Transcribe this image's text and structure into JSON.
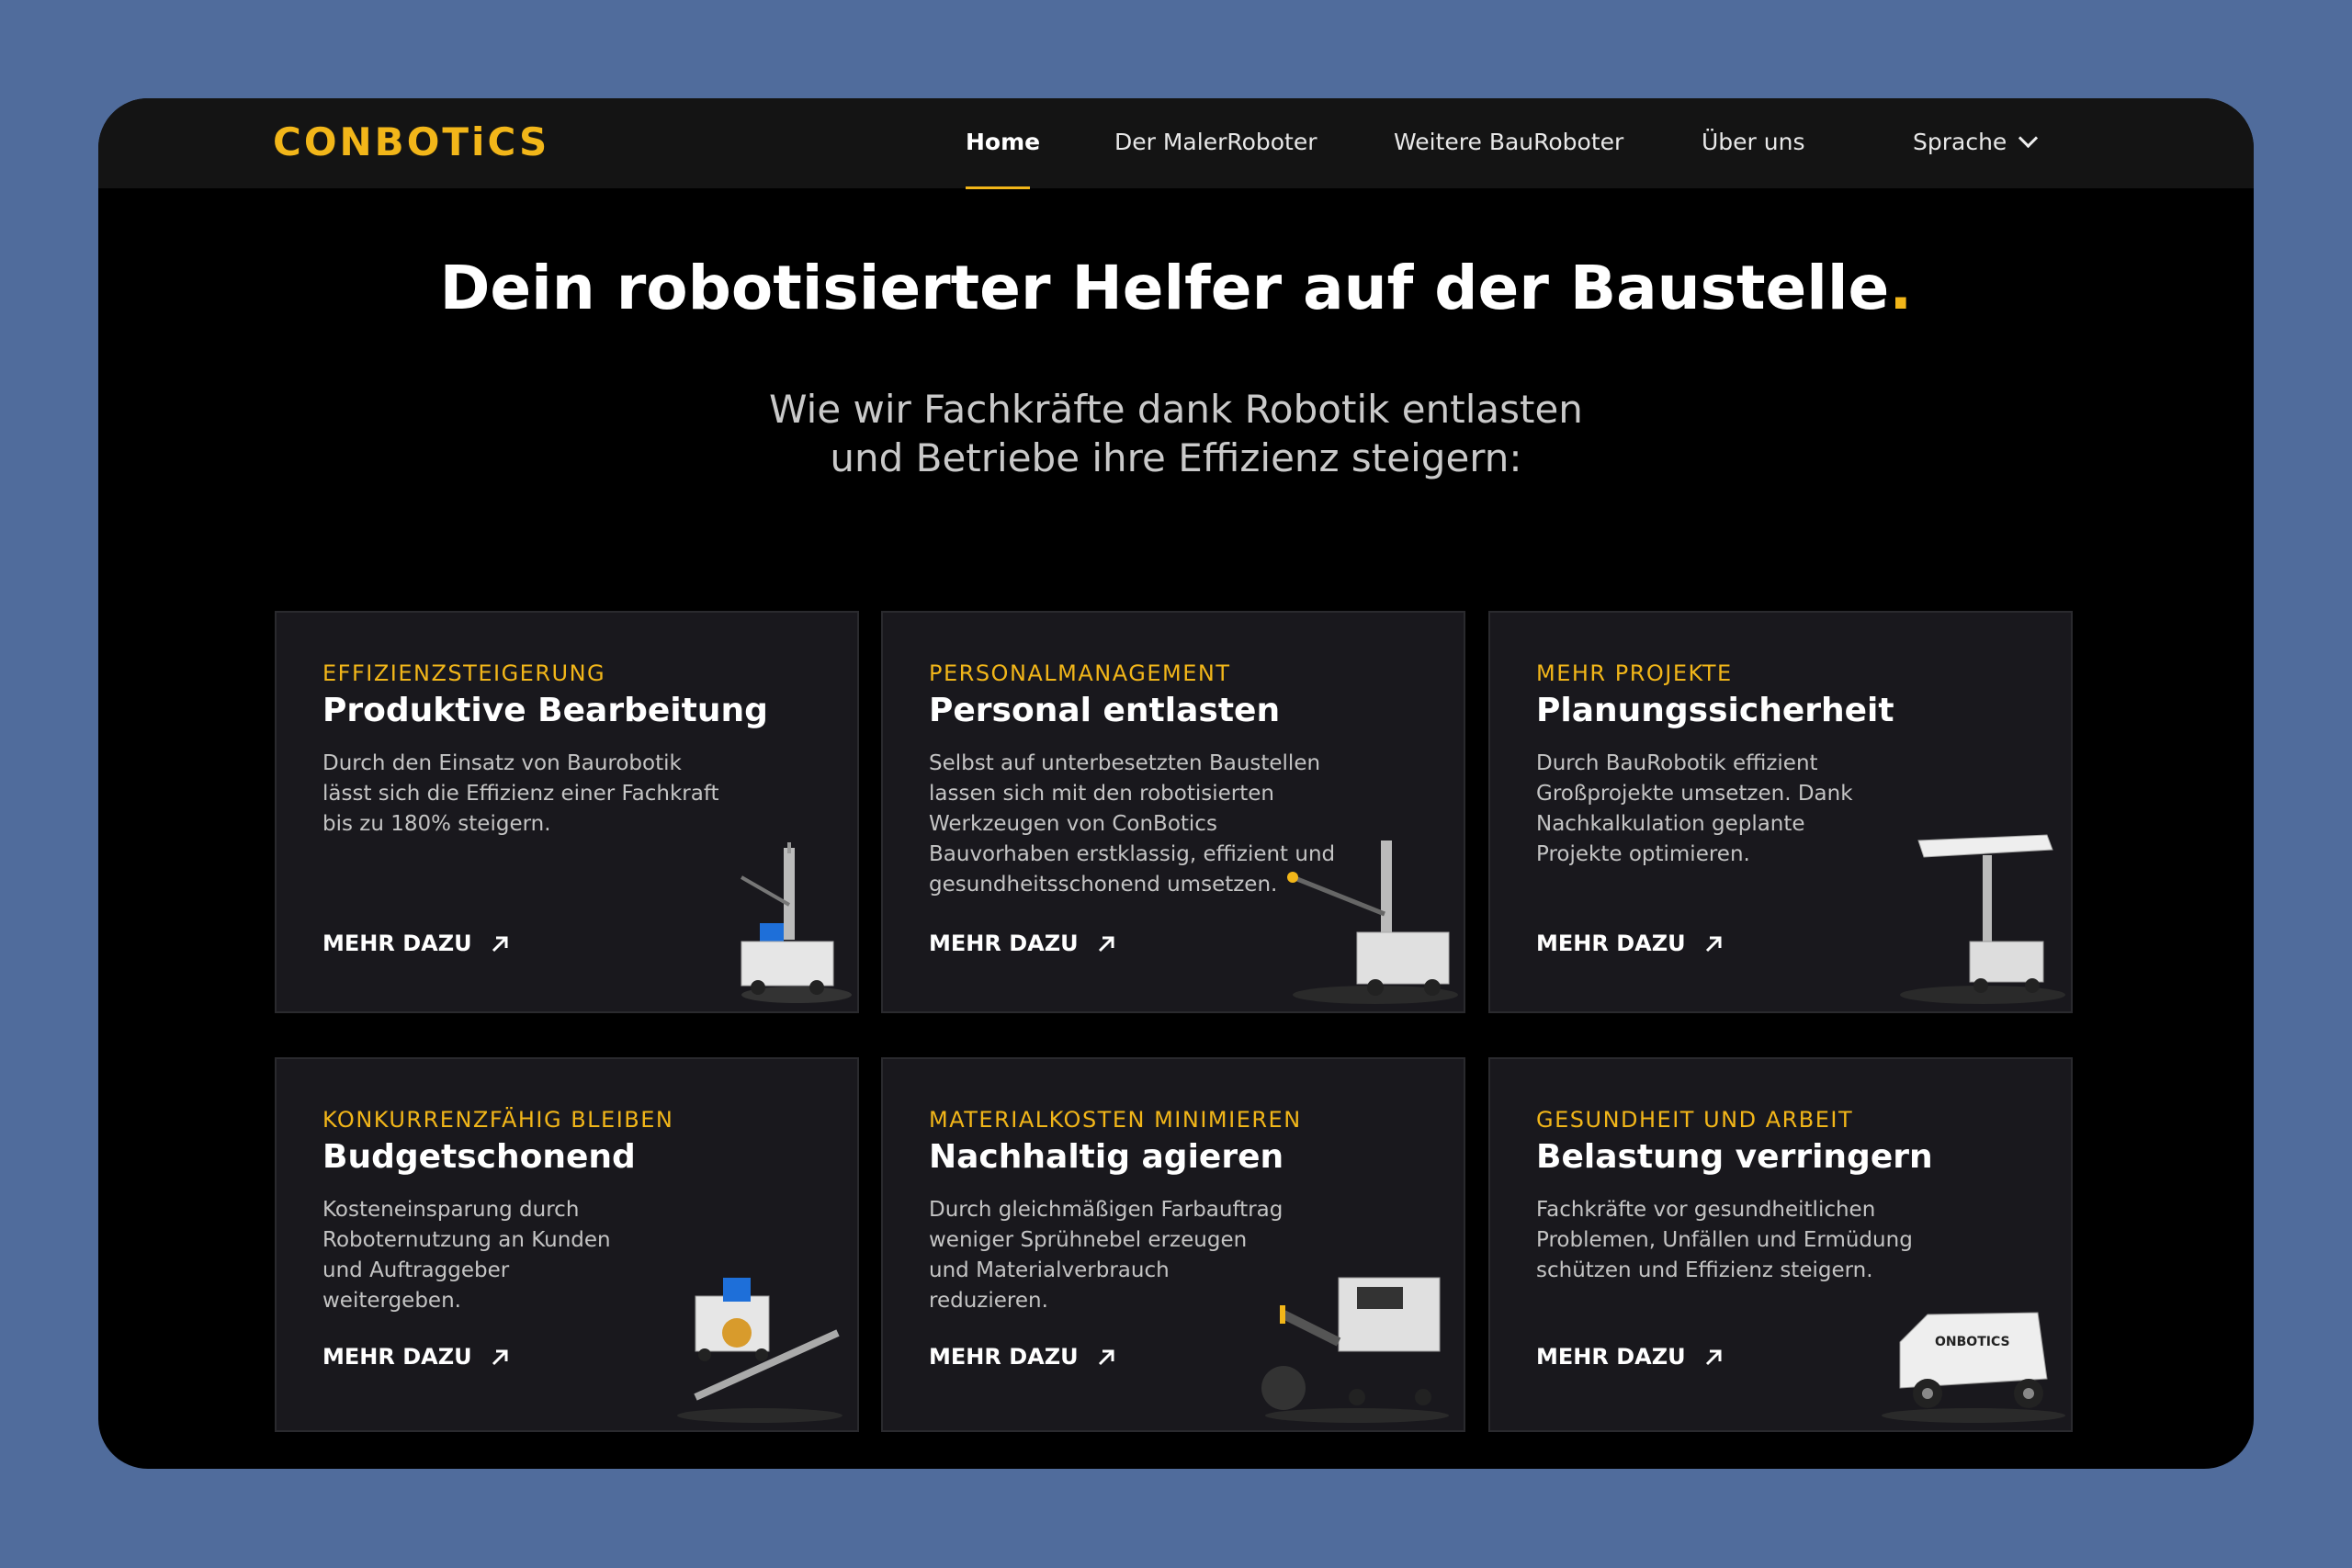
{
  "nav": {
    "logo": "CONBOTiCS",
    "items": [
      "Home",
      "Der MalerRoboter",
      "Weitere BauRoboter",
      "Über uns"
    ],
    "language": "Sprache"
  },
  "hero": {
    "title": "Dein robotisierter Helfer auf der Baustelle",
    "title_dot": ".",
    "subtitle_line1": "Wie wir Fachkräfte dank Robotik entlasten",
    "subtitle_line2": "und Betriebe ihre Effizienz steigern:"
  },
  "cards": [
    {
      "category": "EFFIZIENZSTEIGERUNG",
      "title": "Produktive Bearbeitung",
      "desc_lines": [
        "Durch den Einsatz von Baurobotik",
        "lässt sich die Effizienz einer Fachkraft",
        "bis zu 180% steigern."
      ],
      "more": "MEHR DAZU"
    },
    {
      "category": "PERSONALMANAGEMENT",
      "title": "Personal entlasten",
      "desc_lines": [
        "Selbst auf unterbesetzten Baustellen",
        "lassen sich mit den robotisierten",
        "Werkzeugen von ConBotics",
        "Bauvorhaben erstklassig, effizient und",
        "gesundheitsschonend umsetzen."
      ],
      "more": "MEHR DAZU"
    },
    {
      "category": "MEHR PROJEKTE",
      "title": "Planungssicherheit",
      "desc_lines": [
        "Durch BauRobotik effizient",
        "Großprojekte umsetzen. Dank",
        "Nachkalkulation geplante",
        "Projekte optimieren."
      ],
      "more": "MEHR DAZU"
    },
    {
      "category": "KONKURRENZFÄHIG BLEIBEN",
      "title": "Budgetschonend",
      "desc_lines": [
        "Kosteneinsparung durch",
        "Roboternutzung an Kunden",
        "und Auftraggeber",
        "weitergeben."
      ],
      "more": "MEHR DAZU"
    },
    {
      "category": "MATERIALKOSTEN MINIMIEREN",
      "title": "Nachhaltig agieren",
      "desc_lines": [
        "Durch gleichmäßigen Farbauftrag",
        "weniger Sprühnebel erzeugen",
        "und Materialverbrauch",
        "reduzieren."
      ],
      "more": "MEHR DAZU"
    },
    {
      "category": "GESUNDHEIT UND ARBEIT",
      "title": "Belastung verringern",
      "desc_lines": [
        "Fachkräfte vor gesundheitlichen",
        "Problemen, Unfällen und Ermüdung",
        "schützen und Effizienz steigern."
      ],
      "more": "MEHR DAZU"
    }
  ],
  "robot_label": "ONBOTICS",
  "colors": {
    "accent": "#f2b619",
    "card_bg": "#19181d",
    "page_bg": "#506c9c"
  }
}
